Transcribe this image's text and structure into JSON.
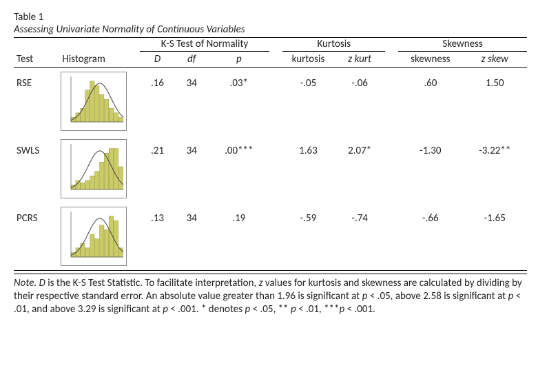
{
  "title": {
    "number": "Table 1",
    "caption": "Assessing Univariate Normality of Continuous Variables"
  },
  "headers": {
    "ks": "K-S Test of Normality",
    "kurt": "Kurtosis",
    "skew": "Skewness",
    "test": "Test",
    "hist": "Histogram",
    "D": "D",
    "df": "df",
    "p": "p",
    "kurtosis": "kurtosis",
    "zkurt": "z kurt",
    "skewness": "skewness",
    "zskew": "z skew"
  },
  "rows": [
    {
      "test": "RSE",
      "D": ".16",
      "df": "34",
      "p": ".03*",
      "kurt": "-.05",
      "zkurt": "-.06",
      "skew": ".60",
      "zskew": "1.50"
    },
    {
      "test": "SWLS",
      "D": ".21",
      "df": "34",
      "p": ".00***",
      "kurt": "1.63",
      "zkurt": "2.07*",
      "skew": "-1.30",
      "zskew": "-3.22**"
    },
    {
      "test": "PCRS",
      "D": ".13",
      "df": "34",
      "p": ".19",
      "kurt": "-.59",
      "zkurt": "-.74",
      "skew": "-.66",
      "zskew": "-1.65"
    }
  ],
  "note_label": "Note.",
  "note_t1": " ",
  "note_D": "D",
  "note_t2": " is the K-S Test Statistic. To facilitate interpretation, ",
  "note_z": "z",
  "note_t3": " values for kurtosis and skewness are calculated by dividing by their respective standard error. An absolute value greater than 1.96 is significant at ",
  "note_p1": "p",
  "note_t4": " < .05, above 2.58 is significant at ",
  "note_p2": "p",
  "note_t5": " < .01, and above 3.29 is significant at ",
  "note_p3": "p",
  "note_t6": " < .001. * denotes ",
  "note_p4": "p",
  "note_t7": " < .05, ** ",
  "note_p5": "p",
  "note_t8": " < .01, ***",
  "note_p6": "p",
  "note_t9": " < .001.",
  "chart_data": [
    {
      "type": "bar",
      "name": "RSE histogram",
      "values": [
        1,
        2,
        3,
        7,
        9,
        8,
        6,
        5,
        3,
        2,
        1
      ],
      "title": "",
      "xlabel": "",
      "ylabel": "",
      "ylim": [
        0,
        10
      ],
      "overlay": "normal-curve",
      "bar_color": "#cccc66"
    },
    {
      "type": "bar",
      "name": "SWLS histogram",
      "values": [
        1,
        2,
        1.5,
        2,
        3,
        4,
        6,
        8,
        9,
        9,
        5
      ],
      "title": "",
      "xlabel": "",
      "ylabel": "",
      "ylim": [
        0,
        10
      ],
      "overlay": "normal-curve",
      "bar_color": "#cccc66"
    },
    {
      "type": "bar",
      "name": "PCRS histogram",
      "values": [
        1,
        2,
        3,
        2,
        5,
        4,
        7,
        6,
        9,
        8,
        2
      ],
      "title": "",
      "xlabel": "",
      "ylabel": "",
      "ylim": [
        0,
        10
      ],
      "overlay": "normal-curve",
      "bar_color": "#cccc66"
    }
  ]
}
